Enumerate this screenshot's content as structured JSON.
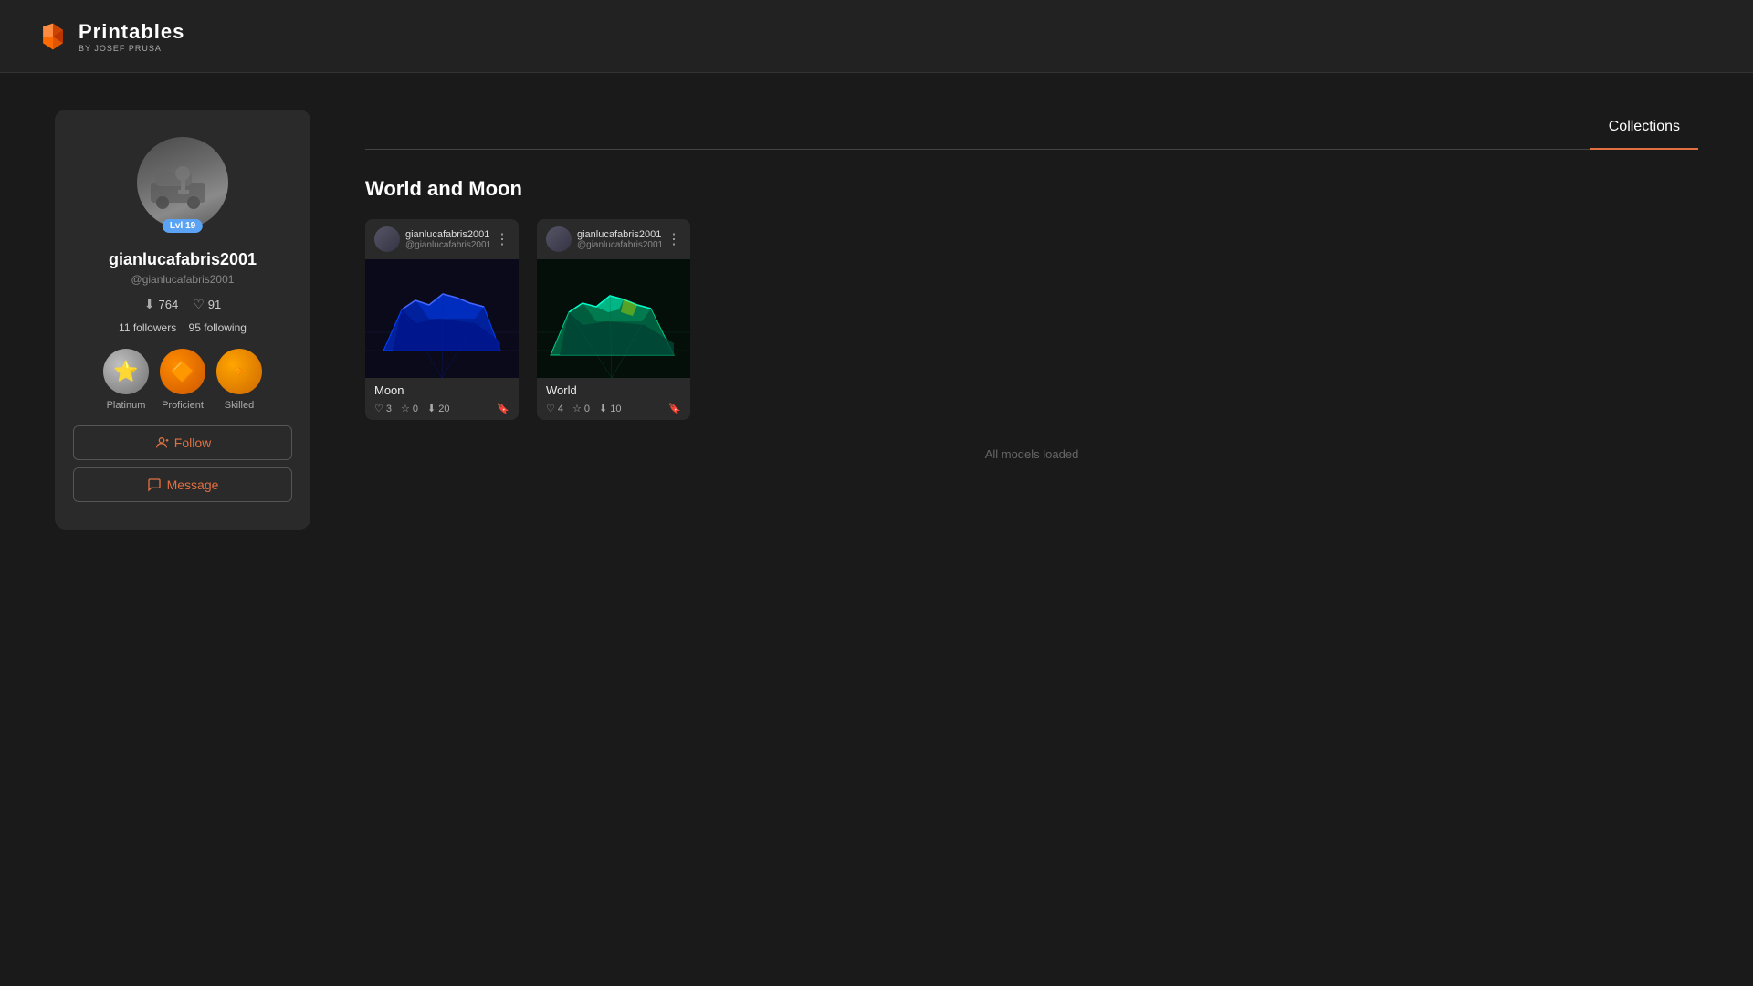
{
  "header": {
    "logo_main": "Printables",
    "logo_sub": "BY JOSEF PRUSA"
  },
  "profile": {
    "username": "gianlucafabris2001",
    "handle": "@gianlucafabris2001",
    "level": "Lvl 19",
    "downloads": "764",
    "likes": "91",
    "followers_count": "11",
    "followers_label": "followers",
    "following_count": "95",
    "following_label": "following",
    "badges": [
      {
        "name": "Platinum",
        "type": "platinum"
      },
      {
        "name": "Proficient",
        "type": "proficient"
      },
      {
        "name": "Skilled",
        "type": "skilled"
      }
    ],
    "follow_button": "Follow",
    "message_button": "Message"
  },
  "tabs": {
    "collections_label": "Collections"
  },
  "collection": {
    "title": "World and Moon",
    "models": [
      {
        "name": "Moon",
        "username": "gianlucafabris2001",
        "handle": "@gianlucafabris2001",
        "likes": "3",
        "stars": "0",
        "downloads": "20",
        "type": "moon"
      },
      {
        "name": "World",
        "username": "gianlucafabris2001",
        "handle": "@gianlucafabris2001",
        "likes": "4",
        "stars": "0",
        "downloads": "10",
        "type": "world"
      }
    ],
    "all_loaded_text": "All models loaded"
  }
}
